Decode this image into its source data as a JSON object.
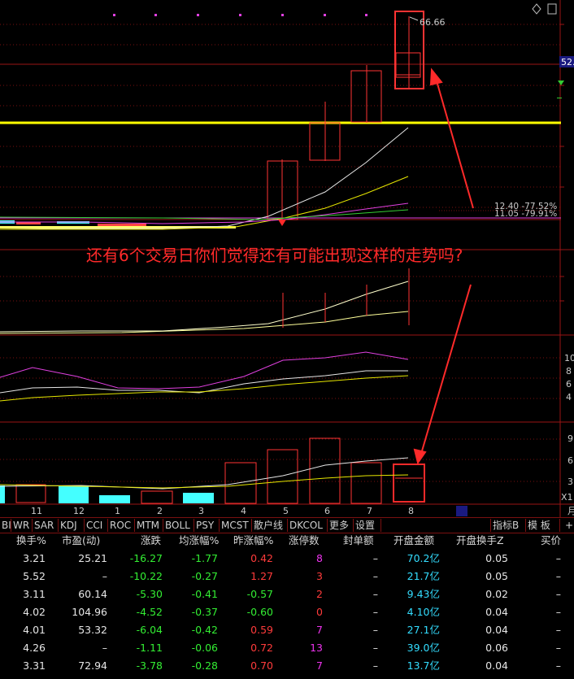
{
  "chart": {
    "price_high_label": "66.66",
    "price_right_tag": "52.",
    "ma_label_1": "12.40 -77.52%",
    "ma_label_2": "11.05 -79.91%",
    "right_axis_mid": [
      "10",
      "8",
      "6",
      "4"
    ],
    "right_axis_low": [
      "9",
      "6",
      "3"
    ],
    "x_label_right": "X1",
    "x_dates": [
      "11",
      "12",
      "1",
      "2",
      "3",
      "4",
      "5",
      "6",
      "7",
      "8"
    ],
    "annotation": "还有6个交易日你们觉得还有可能出现这样的走势吗?",
    "corner_mark": "月",
    "colors": {
      "grid": "#7a1010",
      "candle": "#ff3333",
      "highlight_line": "#ffff00",
      "ma_white": "#e6e6e6",
      "ma_yellow": "#e6e600",
      "ma_magenta": "#e040e0",
      "ma_green": "#33cc33",
      "volume_cyan": "#44ffff"
    }
  },
  "tabs": [
    "BI",
    "WR",
    "SAR",
    "KDJ",
    "CCI",
    "ROC",
    "MTM",
    "BOLL",
    "PSY",
    "MCST",
    "散户线",
    "DKCOL",
    "更多",
    "设置"
  ],
  "tabs_right": [
    "指标B",
    "模 板",
    "+"
  ],
  "table": {
    "headers": [
      "换手%",
      "市盈(动)",
      "涨跌",
      "均涨幅%",
      "昨涨幅%",
      "涨停数",
      "封单额",
      "开盘金额",
      "开盘换手Z",
      "买价"
    ],
    "rows": [
      [
        "3.21",
        "25.21",
        "-16.27",
        "-1.77",
        "0.42",
        "8",
        "–",
        "70.2亿",
        "0.05",
        "–"
      ],
      [
        "5.52",
        "–",
        "-10.22",
        "-0.27",
        "1.27",
        "3",
        "–",
        "21.7亿",
        "0.05",
        "–"
      ],
      [
        "3.11",
        "60.14",
        "-5.30",
        "-0.41",
        "-0.57",
        "2",
        "–",
        "9.43亿",
        "0.02",
        "–"
      ],
      [
        "4.02",
        "104.96",
        "-4.52",
        "-0.37",
        "-0.60",
        "0",
        "–",
        "4.10亿",
        "0.04",
        "–"
      ],
      [
        "4.01",
        "53.32",
        "-6.04",
        "-0.42",
        "0.59",
        "7",
        "–",
        "27.1亿",
        "0.04",
        "–"
      ],
      [
        "4.26",
        "–",
        "-1.11",
        "-0.06",
        "0.72",
        "13",
        "–",
        "39.0亿",
        "0.06",
        "–"
      ],
      [
        "3.31",
        "72.94",
        "-3.78",
        "-0.28",
        "0.70",
        "7",
        "–",
        "13.7亿",
        "0.04",
        "–"
      ]
    ]
  }
}
